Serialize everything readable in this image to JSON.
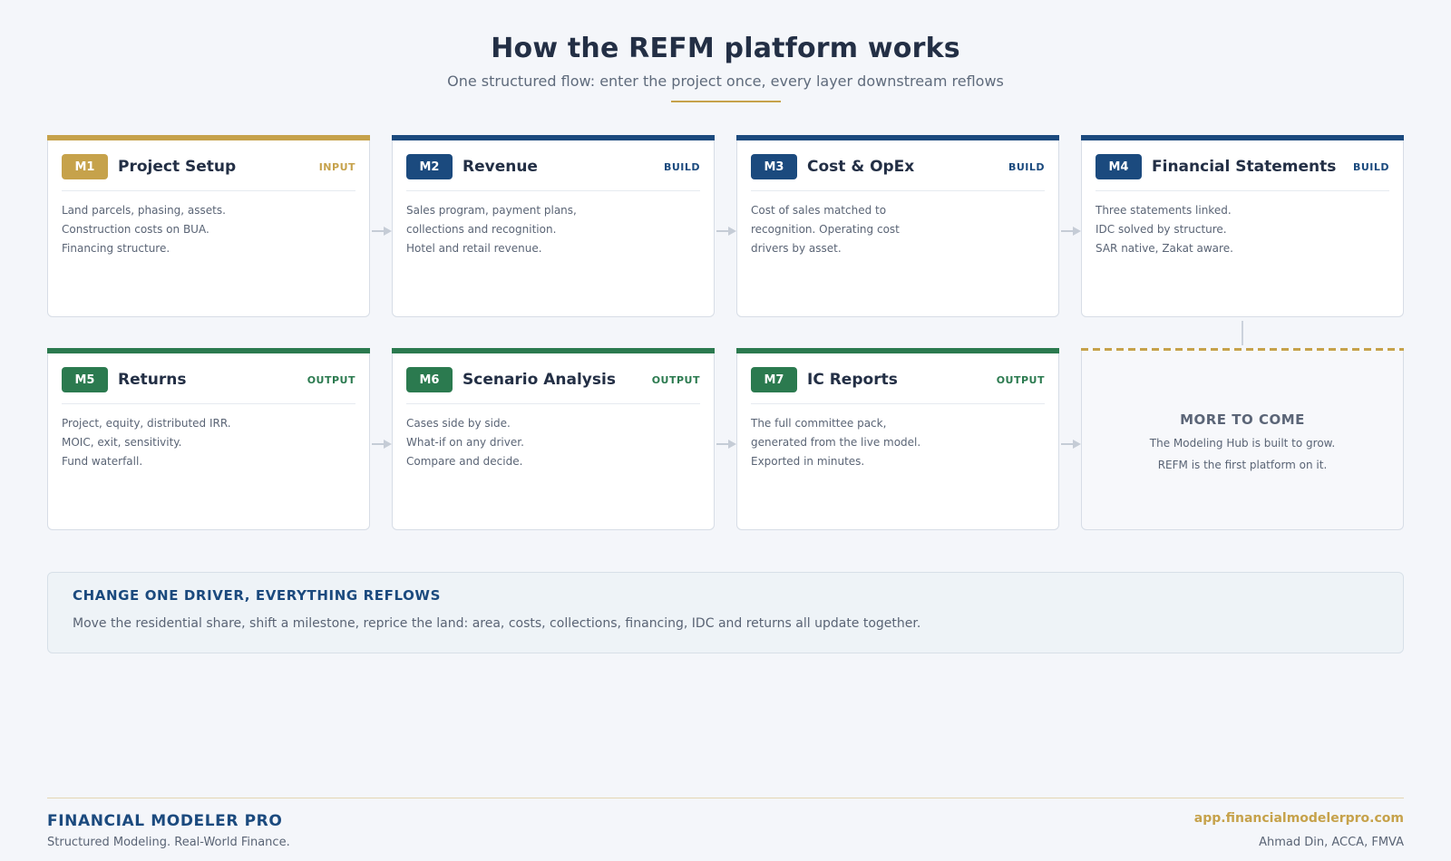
{
  "header": {
    "title": "How the REFM platform works",
    "subtitle": "One structured flow: enter the project once, every layer downstream reflows"
  },
  "colors": {
    "input": "#c6a24b",
    "build": "#1b4a7e",
    "output": "#2b7a4f"
  },
  "modules": [
    {
      "code": "M1",
      "name": "Project Setup",
      "role": "INPUT",
      "lines": [
        "Land parcels, phasing, assets.",
        "Construction costs on BUA.",
        "Financing structure."
      ]
    },
    {
      "code": "M2",
      "name": "Revenue",
      "role": "BUILD",
      "lines": [
        "Sales program, payment plans,",
        "collections and recognition.",
        "Hotel and retail revenue."
      ]
    },
    {
      "code": "M3",
      "name": "Cost & OpEx",
      "role": "BUILD",
      "lines": [
        "Cost of sales matched to",
        "recognition. Operating cost",
        "drivers by asset."
      ]
    },
    {
      "code": "M4",
      "name": "Financial Statements",
      "role": "BUILD",
      "lines": [
        "Three statements linked.",
        "IDC solved by structure.",
        "SAR native, Zakat aware."
      ]
    },
    {
      "code": "M5",
      "name": "Returns",
      "role": "OUTPUT",
      "lines": [
        "Project, equity, distributed IRR.",
        "MOIC, exit, sensitivity.",
        "Fund waterfall."
      ]
    },
    {
      "code": "M6",
      "name": "Scenario Analysis",
      "role": "OUTPUT",
      "lines": [
        "Cases side by side.",
        "What-if on any driver.",
        "Compare and decide."
      ]
    },
    {
      "code": "M7",
      "name": "IC Reports",
      "role": "OUTPUT",
      "lines": [
        "The full committee pack,",
        "generated from the live model.",
        "Exported in minutes."
      ]
    }
  ],
  "more": {
    "title": "MORE TO COME",
    "lines": [
      "The Modeling Hub is built to grow.",
      "REFM is the first platform on it."
    ]
  },
  "callout": {
    "title": "CHANGE ONE DRIVER, EVERYTHING REFLOWS",
    "text": "Move the residential share, shift a milestone, reprice the land: area, costs, collections, financing, IDC and returns all update together."
  },
  "footer": {
    "brand": "FINANCIAL MODELER PRO",
    "tagline": "Structured Modeling. Real-World Finance.",
    "url": "app.financialmodelerpro.com",
    "author": "Ahmad Din, ACCA, FMVA"
  }
}
